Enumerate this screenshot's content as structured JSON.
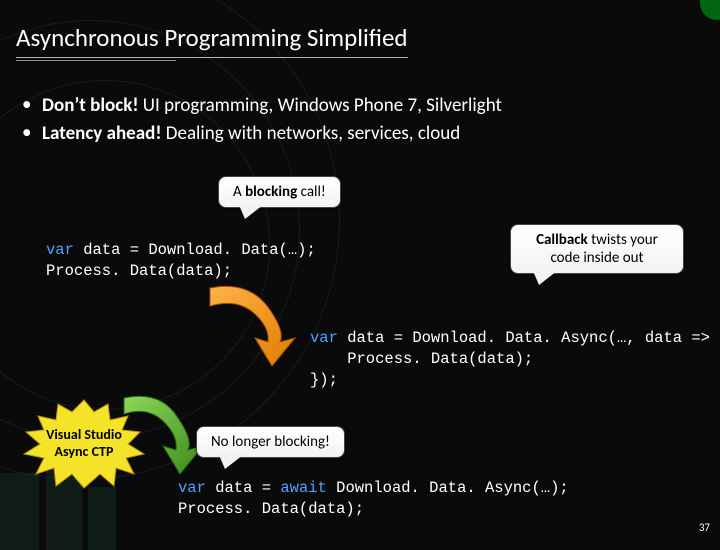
{
  "title": "Asynchronous Programming Simplified",
  "bullets": [
    {
      "bold": "Don’t block!",
      "rest": "  UI programming, Windows Phone 7, Silverlight"
    },
    {
      "bold": "Latency ahead!",
      "rest": "  Dealing with networks, services, cloud"
    }
  ],
  "callouts": {
    "blocking": {
      "text_before": "A ",
      "bold": "blocking",
      "text_after": " call!"
    },
    "callback": {
      "line1_before": "",
      "line1_bold": "Callback",
      "line1_after": " twists your",
      "line2": "code inside out"
    },
    "nonblocking": "No longer blocking!"
  },
  "code": {
    "block1_line1_kw": "var",
    "block1_line1_rest": " data = Download. Data(…);",
    "block1_line2": "Process. Data(data);",
    "block2_line1_kw": "var",
    "block2_line1_rest": " data = Download. Data. Async(…, data => {",
    "block2_line2": "    Process. Data(data);",
    "block2_line3": "});",
    "block3_line1_kw1": "var",
    "block3_line1_mid": " data = ",
    "block3_line1_kw2": "await",
    "block3_line1_rest": " Download. Data. Async(…);",
    "block3_line2": "Process. Data(data);"
  },
  "shapes": {
    "starburst_line1": "Visual Studio",
    "starburst_line2": "Async CTP"
  },
  "page_number": "37"
}
